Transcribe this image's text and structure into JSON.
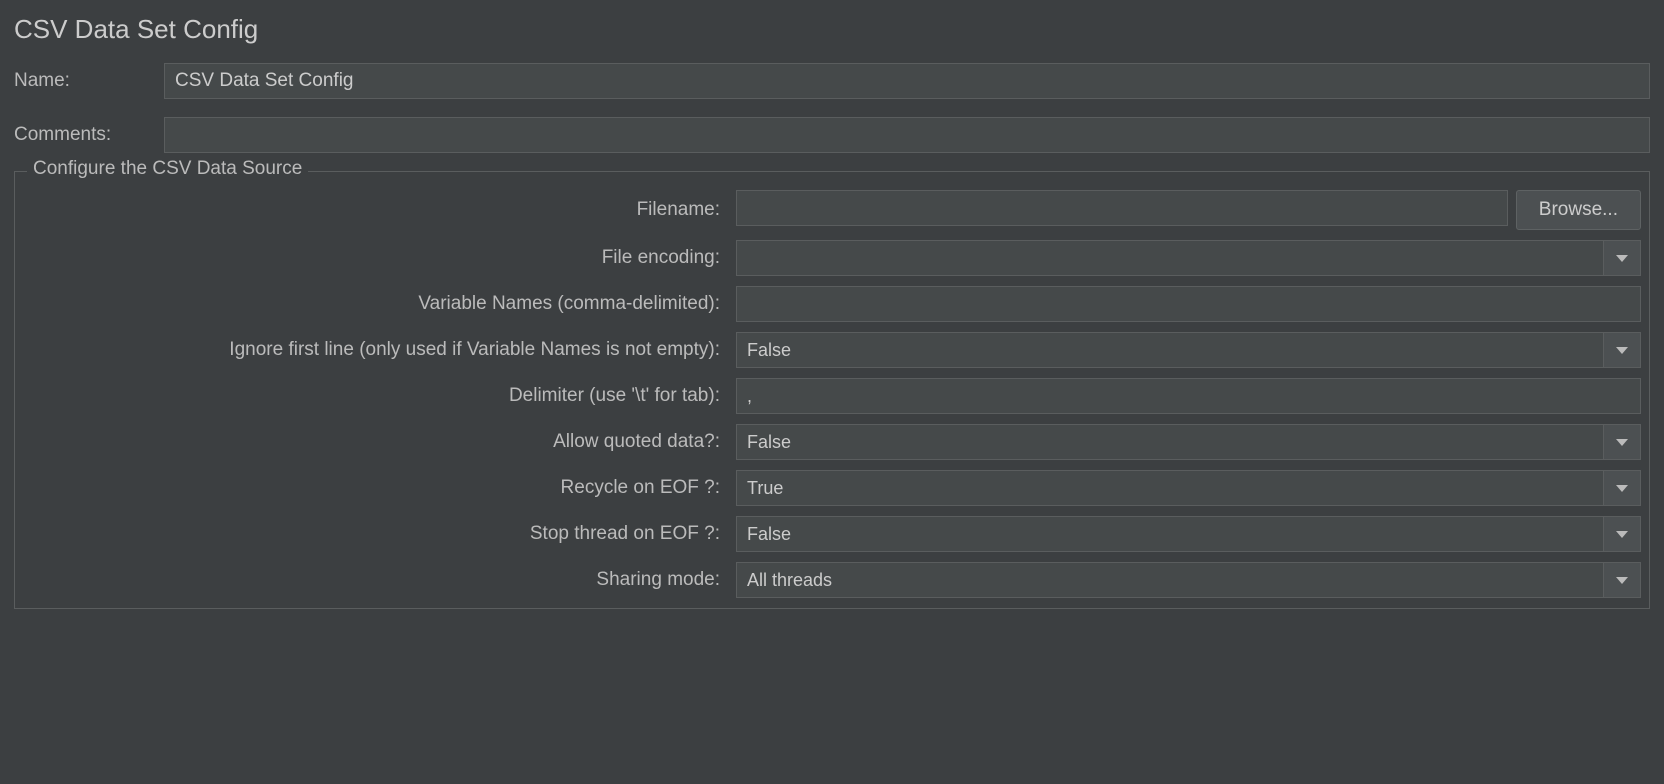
{
  "title": "CSV Data Set Config",
  "top_fields": {
    "name_label": "Name:",
    "name_value": "CSV Data Set Config",
    "comments_label": "Comments:",
    "comments_value": ""
  },
  "fieldset_legend": "Configure the CSV Data Source",
  "rows": {
    "filename": {
      "label": "Filename:",
      "value": "",
      "browse": "Browse..."
    },
    "encoding": {
      "label": "File encoding:",
      "value": ""
    },
    "varnames": {
      "label": "Variable Names (comma-delimited):",
      "value": ""
    },
    "ignore_first": {
      "label": "Ignore first line (only used if Variable Names is not empty):",
      "value": "False"
    },
    "delimiter": {
      "label": "Delimiter (use '\\t' for tab):",
      "value": ","
    },
    "allow_quoted": {
      "label": "Allow quoted data?:",
      "value": "False"
    },
    "recycle": {
      "label": "Recycle on EOF ?:",
      "value": "True"
    },
    "stop_thread": {
      "label": "Stop thread on EOF ?:",
      "value": "False"
    },
    "sharing": {
      "label": "Sharing mode:",
      "value": "All threads"
    }
  }
}
